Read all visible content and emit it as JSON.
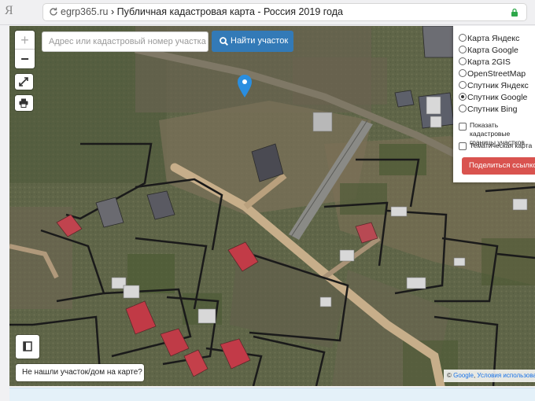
{
  "browser": {
    "logo": "Я",
    "host": "egrp365.ru",
    "separator": "›",
    "page_title": "Публичная кадастровая карта - Россия 2019 года"
  },
  "map_controls": {
    "zoom_in": "+",
    "zoom_out": "−"
  },
  "search": {
    "placeholder": "Адрес или кадастровый номер участка",
    "button_label": "Найти участок"
  },
  "layers": [
    {
      "label": "Карта Яндекс",
      "selected": false
    },
    {
      "label": "Карта Google",
      "selected": false
    },
    {
      "label": "Карта 2GIS",
      "selected": false
    },
    {
      "label": "OpenStreetMap",
      "selected": false
    },
    {
      "label": "Спутник Яндекс",
      "selected": false
    },
    {
      "label": "Спутник Google",
      "selected": true
    },
    {
      "label": "Спутник Bing",
      "selected": false
    }
  ],
  "options": {
    "cadastral_line1": "Показать кадастровые",
    "cadastral_line2": "границы участков",
    "thematic": "Тематическая карта",
    "share_label": "Поделиться ссылкой"
  },
  "not_found_label": "Не нашли участок/дом на карте?",
  "attribution": {
    "symbol": "©",
    "provider": "Google",
    "separator": ",",
    "terms": "Условия использования"
  },
  "colors": {
    "primary_button": "#337ab7",
    "share_button": "#d9534f",
    "marker": "#2a8ee0",
    "roof_red": "#c23b47",
    "secure_lock": "#2ea84a"
  },
  "icons": {
    "reload": "reload-icon",
    "lock": "lock-icon",
    "fullscreen": "fullscreen-icon",
    "print": "print-icon",
    "search": "search-icon",
    "legend": "book-icon",
    "marker": "map-marker-icon"
  }
}
